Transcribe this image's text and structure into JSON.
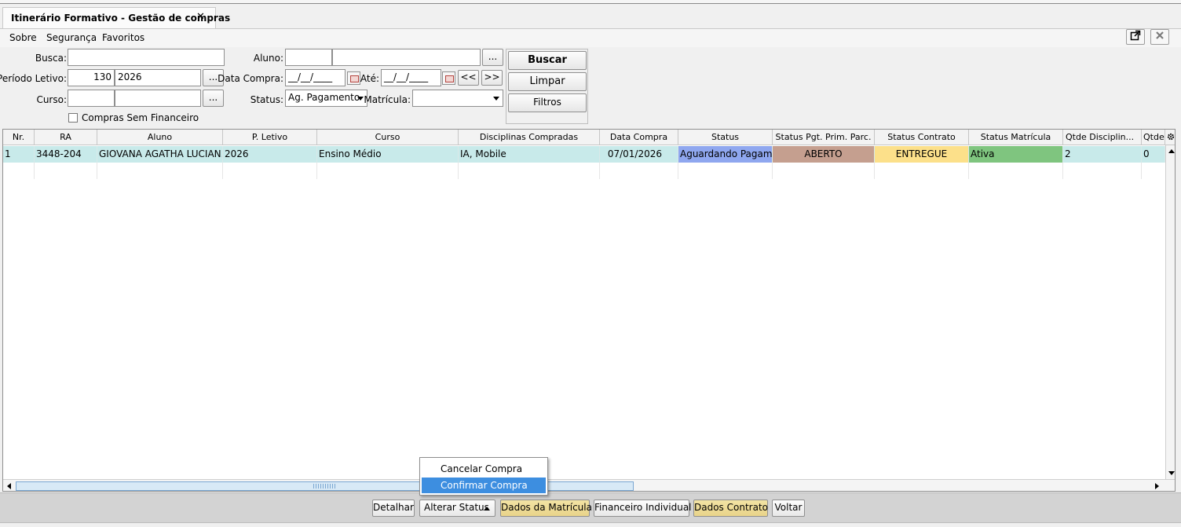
{
  "window": {
    "tab_title": "Itinerário Formativo - Gestão de compras",
    "tab_close": "✕",
    "open_external_icon": "external-link-icon",
    "close_icon": "close-icon"
  },
  "menu": [
    "Sobre",
    "Segurança",
    "Favoritos"
  ],
  "filters": {
    "busca_label": "Busca:",
    "busca_value": "",
    "aluno_label": "Aluno:",
    "aluno_code": "",
    "aluno_name": "",
    "ellipsis": "...",
    "periodo_label": "Período Letivo:",
    "periodo_code": "130",
    "periodo_year": "2026",
    "data_compra_label": "Data Compra:",
    "data_compra_value": "__/__/____",
    "ate_label": "Até:",
    "ate_value": "__/__/____",
    "prev_label": "<<",
    "next_label": ">>",
    "curso_label": "Curso:",
    "curso_code": "",
    "curso_name": "",
    "status_label": "Status:",
    "status_value": "Ag. Pagamento",
    "matricula_label": "Matrícula:",
    "matricula_value": "",
    "sem_financeiro_label": "Compras Sem Financeiro",
    "sem_financeiro_checked": false
  },
  "actions": {
    "buscar": "Buscar",
    "limpar": "Limpar",
    "filtros": "Filtros"
  },
  "table": {
    "columns": [
      "Nr.",
      "RA",
      "Aluno",
      "P. Letivo",
      "Curso",
      "Disciplinas Compradas",
      "Data Compra",
      "Status",
      "Status Pgt. Prim. Parc.",
      "Status Contrato",
      "Status Matrícula",
      "Qtde Disciplin...",
      "Qtde"
    ],
    "rows": [
      {
        "nr": "1",
        "ra": "3448-204",
        "aluno": "GIOVANA AGATHA LUCIAN...",
        "p_letivo": "2026",
        "curso": "Ensino Médio",
        "disciplinas": "IA, Mobile",
        "data_compra": "07/01/2026",
        "status": "Aguardando Pagam...",
        "status_pgt": "ABERTO",
        "status_contrato": "ENTREGUE",
        "status_matricula": "Ativa",
        "qtde_disciplinas": "2",
        "qtde": "0"
      }
    ],
    "colors": {
      "row_bg": "#c8eaea",
      "status_bg": "#8fa7ef",
      "pgt_bg": "#c59f8f",
      "contrato_bg": "#fce08a",
      "matricula_bg": "#7fc57f"
    },
    "settings_icon": "gear-icon"
  },
  "context_menu": {
    "items": [
      "Cancelar Compra",
      "Confirmar Compra"
    ],
    "highlighted": "Confirmar Compra"
  },
  "bottom_buttons": {
    "detalhar": "Detalhar",
    "alterar_status": "Alterar Status",
    "dados_matricula": "Dados da Matrícula",
    "financeiro_individual": "Financeiro Individual",
    "dados_contrato": "Dados Contrato",
    "voltar": "Voltar"
  }
}
